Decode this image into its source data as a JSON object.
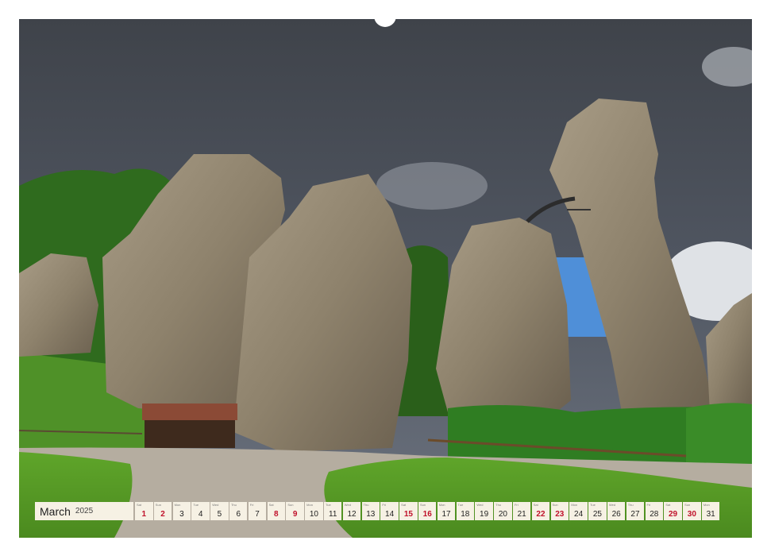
{
  "calendar": {
    "month": "March",
    "year": "2025",
    "days": [
      {
        "n": "1",
        "w": "Sat",
        "we": true
      },
      {
        "n": "2",
        "w": "Sun",
        "we": true
      },
      {
        "n": "3",
        "w": "Mon",
        "we": false
      },
      {
        "n": "4",
        "w": "Tue",
        "we": false
      },
      {
        "n": "5",
        "w": "Wed",
        "we": false
      },
      {
        "n": "6",
        "w": "Thu",
        "we": false
      },
      {
        "n": "7",
        "w": "Fri",
        "we": false
      },
      {
        "n": "8",
        "w": "Sat",
        "we": true
      },
      {
        "n": "9",
        "w": "Sun",
        "we": true
      },
      {
        "n": "10",
        "w": "Mon",
        "we": false
      },
      {
        "n": "11",
        "w": "Tue",
        "we": false
      },
      {
        "n": "12",
        "w": "Wed",
        "we": false
      },
      {
        "n": "13",
        "w": "Thu",
        "we": false
      },
      {
        "n": "14",
        "w": "Fri",
        "we": false
      },
      {
        "n": "15",
        "w": "Sat",
        "we": true
      },
      {
        "n": "16",
        "w": "Sun",
        "we": true
      },
      {
        "n": "17",
        "w": "Mon",
        "we": false
      },
      {
        "n": "18",
        "w": "Tue",
        "we": false
      },
      {
        "n": "19",
        "w": "Wed",
        "we": false
      },
      {
        "n": "20",
        "w": "Thu",
        "we": false
      },
      {
        "n": "21",
        "w": "Fri",
        "we": false
      },
      {
        "n": "22",
        "w": "Sat",
        "we": true
      },
      {
        "n": "23",
        "w": "Sun",
        "we": true
      },
      {
        "n": "24",
        "w": "Mon",
        "we": false
      },
      {
        "n": "25",
        "w": "Tue",
        "we": false
      },
      {
        "n": "26",
        "w": "Wed",
        "we": false
      },
      {
        "n": "27",
        "w": "Thu",
        "we": false
      },
      {
        "n": "28",
        "w": "Fri",
        "we": false
      },
      {
        "n": "29",
        "w": "Sat",
        "we": true
      },
      {
        "n": "30",
        "w": "Sun",
        "we": true
      },
      {
        "n": "31",
        "w": "Mon",
        "we": false
      }
    ]
  },
  "colors": {
    "weekend": "#c0112b",
    "cell_bg": "#f6f1e4"
  }
}
